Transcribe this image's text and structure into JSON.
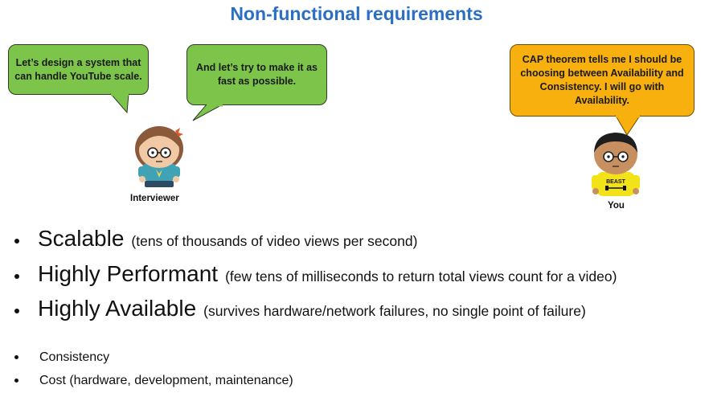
{
  "title": "Non-functional requirements",
  "bubbles": {
    "interviewer_1": "Let’s design a system that can handle YouTube scale.",
    "interviewer_2": "And let’s try to make it as fast as possible.",
    "you": "CAP theorem tells me I should be choosing between Availability and Consistency. I will go with Availability."
  },
  "characters": {
    "interviewer": "Interviewer",
    "you": "You",
    "shirt_text": "BEAST"
  },
  "primary_requirements": [
    {
      "name": "Scalable",
      "detail": "(tens of thousands of video views per second)"
    },
    {
      "name": "Highly Performant",
      "detail": "(few tens of milliseconds to return total views count for a video)"
    },
    {
      "name": "Highly Available",
      "detail": "(survives hardware/network failures, no single point of failure)"
    }
  ],
  "secondary_requirements": [
    "Consistency",
    "Cost (hardware, development, maintenance)"
  ],
  "colors": {
    "title": "#2a6fc4",
    "green_bubble": "#7cc44a",
    "orange_bubble": "#f7b00e"
  }
}
